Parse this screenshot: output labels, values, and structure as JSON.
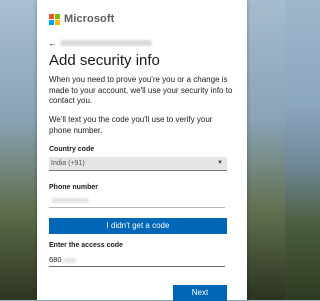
{
  "brand": {
    "name": "Microsoft",
    "logo_colors": [
      "#f25022",
      "#7fba00",
      "#00a4ef",
      "#ffb900"
    ]
  },
  "header": {
    "title": "Add security info"
  },
  "text": {
    "p1": "When you need to prove you're you or a change is made to your account, we'll use your security info to contact you.",
    "p2": "We'll text you the code you'll use to verify your phone number."
  },
  "form": {
    "country_label": "Country code",
    "country_value": "India (+91)",
    "phone_label": "Phone number",
    "didnt_get_code_label": "I didn't get a code",
    "access_code_label": "Enter the access code",
    "access_code_value": "680"
  },
  "footer": {
    "next_label": "Next"
  },
  "colors": {
    "accent": "#0067b8"
  }
}
